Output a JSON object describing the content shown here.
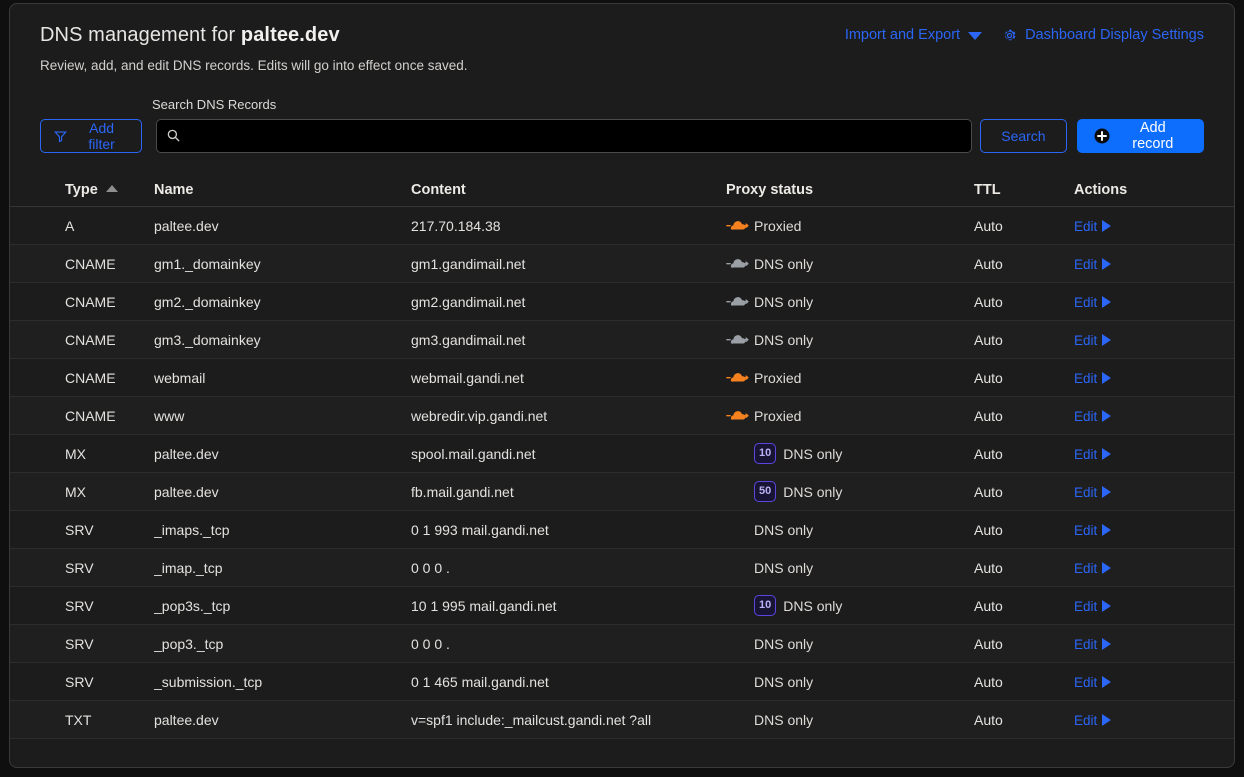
{
  "header": {
    "title_prefix": "DNS management for ",
    "domain": "paltee.dev",
    "subtitle": "Review, add, and edit DNS records. Edits will go into effect once saved.",
    "import_export_label": "Import and Export",
    "dashboard_settings_label": "Dashboard Display Settings"
  },
  "toolbar": {
    "add_filter_label": "Add filter",
    "search_label": "Search DNS Records",
    "search_value": "",
    "search_placeholder": "",
    "search_button_label": "Search",
    "add_record_label": "Add record"
  },
  "table": {
    "columns": {
      "type": "Type",
      "name": "Name",
      "content": "Content",
      "proxy_status": "Proxy status",
      "ttl": "TTL",
      "actions": "Actions"
    },
    "sort": {
      "column": "Type",
      "direction": "asc"
    },
    "edit_label": "Edit",
    "rows": [
      {
        "type": "A",
        "name": "paltee.dev",
        "content": "217.70.184.38",
        "proxy_icon": "cloud-orange",
        "priority": "",
        "proxy": "Proxied",
        "ttl": "Auto",
        "edit": "Edit"
      },
      {
        "type": "CNAME",
        "name": "gm1._domainkey",
        "content": "gm1.gandimail.net",
        "proxy_icon": "cloud-grey",
        "priority": "",
        "proxy": "DNS only",
        "ttl": "Auto",
        "edit": "Edit"
      },
      {
        "type": "CNAME",
        "name": "gm2._domainkey",
        "content": "gm2.gandimail.net",
        "proxy_icon": "cloud-grey",
        "priority": "",
        "proxy": "DNS only",
        "ttl": "Auto",
        "edit": "Edit"
      },
      {
        "type": "CNAME",
        "name": "gm3._domainkey",
        "content": "gm3.gandimail.net",
        "proxy_icon": "cloud-grey",
        "priority": "",
        "proxy": "DNS only",
        "ttl": "Auto",
        "edit": "Edit"
      },
      {
        "type": "CNAME",
        "name": "webmail",
        "content": "webmail.gandi.net",
        "proxy_icon": "cloud-orange",
        "priority": "",
        "proxy": "Proxied",
        "ttl": "Auto",
        "edit": "Edit"
      },
      {
        "type": "CNAME",
        "name": "www",
        "content": "webredir.vip.gandi.net",
        "proxy_icon": "cloud-orange",
        "priority": "",
        "proxy": "Proxied",
        "ttl": "Auto",
        "edit": "Edit"
      },
      {
        "type": "MX",
        "name": "paltee.dev",
        "content": "spool.mail.gandi.net",
        "proxy_icon": "none",
        "priority": "10",
        "proxy": "DNS only",
        "ttl": "Auto",
        "edit": "Edit"
      },
      {
        "type": "MX",
        "name": "paltee.dev",
        "content": "fb.mail.gandi.net",
        "proxy_icon": "none",
        "priority": "50",
        "proxy": "DNS only",
        "ttl": "Auto",
        "edit": "Edit"
      },
      {
        "type": "SRV",
        "name": "_imaps._tcp",
        "content": "0 1 993 mail.gandi.net",
        "proxy_icon": "none",
        "priority": "",
        "proxy": "DNS only",
        "ttl": "Auto",
        "edit": "Edit"
      },
      {
        "type": "SRV",
        "name": "_imap._tcp",
        "content": "0 0 0 .",
        "proxy_icon": "none",
        "priority": "",
        "proxy": "DNS only",
        "ttl": "Auto",
        "edit": "Edit"
      },
      {
        "type": "SRV",
        "name": "_pop3s._tcp",
        "content": "10 1 995 mail.gandi.net",
        "proxy_icon": "none",
        "priority": "10",
        "proxy": "DNS only",
        "ttl": "Auto",
        "edit": "Edit"
      },
      {
        "type": "SRV",
        "name": "_pop3._tcp",
        "content": "0 0 0 .",
        "proxy_icon": "none",
        "priority": "",
        "proxy": "DNS only",
        "ttl": "Auto",
        "edit": "Edit"
      },
      {
        "type": "SRV",
        "name": "_submission._tcp",
        "content": "0 1 465 mail.gandi.net",
        "proxy_icon": "none",
        "priority": "",
        "proxy": "DNS only",
        "ttl": "Auto",
        "edit": "Edit"
      },
      {
        "type": "TXT",
        "name": "paltee.dev",
        "content": "v=spf1 include:_mailcust.gandi.net ?all",
        "proxy_icon": "none",
        "priority": "",
        "proxy": "DNS only",
        "ttl": "Auto",
        "edit": "Edit"
      }
    ]
  },
  "colors": {
    "accent_blue": "#2b66f6",
    "primary_button": "#0d6efd",
    "proxied_orange": "#f6821f",
    "dns_only_grey": "#9aa0a6",
    "badge_border": "#5b47e0",
    "card_bg": "#1c1c1c",
    "page_bg": "#0f0f0f"
  },
  "icons": {
    "import_export_caret": "chevron-down-icon",
    "settings": "gear-icon",
    "filter": "funnel-icon",
    "search": "search-icon",
    "add": "plus-circle-icon",
    "edit_arrow": "triangle-right-icon"
  }
}
